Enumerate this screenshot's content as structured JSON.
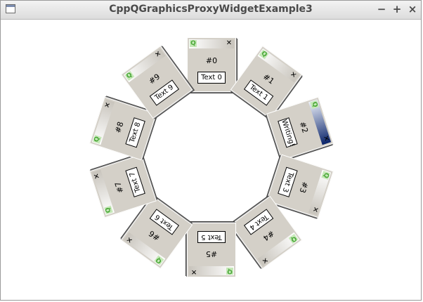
{
  "window": {
    "title": "CppQGraphicsProxyWidgetExample3"
  },
  "icons": {
    "app": "window-icon",
    "qt": "qt",
    "close": "✕"
  },
  "dialogs": [
    {
      "label": "#0",
      "text": "Text 0",
      "angle": 0
    },
    {
      "label": "#1",
      "text": "Text 1",
      "angle": 36
    },
    {
      "label": "#2",
      "text": "Writing!",
      "angle": 72,
      "active": true
    },
    {
      "label": "#3",
      "text": "Text 3",
      "angle": 108
    },
    {
      "label": "#4",
      "text": "Text 4",
      "angle": 144
    },
    {
      "label": "#5",
      "text": "Text 5",
      "angle": 180
    },
    {
      "label": "#6",
      "text": "Text 6",
      "angle": 216
    },
    {
      "label": "#7",
      "text": "Text 7",
      "angle": 252
    },
    {
      "label": "#8",
      "text": "Text 8",
      "angle": 288
    },
    {
      "label": "#9",
      "text": "Text 9",
      "angle": 324
    }
  ]
}
